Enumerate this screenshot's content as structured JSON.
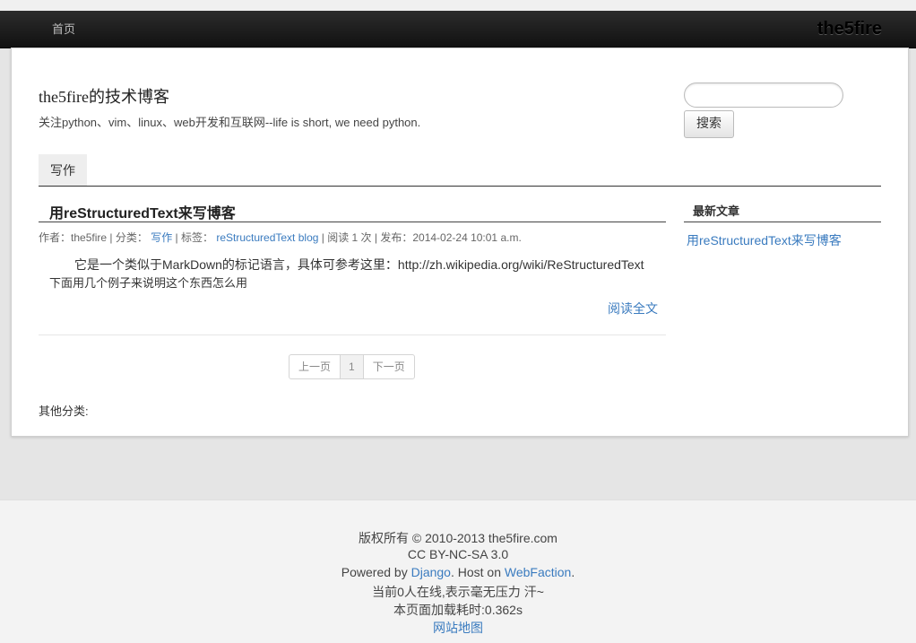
{
  "nav": {
    "home_label": "首页",
    "brand": "the5fire"
  },
  "site": {
    "title": "the5fire的技术博客",
    "tagline": "关注python、vim、linux、web开发和互联网--life is short, we need python."
  },
  "search": {
    "placeholder": "",
    "button_label": "搜索"
  },
  "category_tab": {
    "label": "写作"
  },
  "post": {
    "title": "用reStructuredText来写博客",
    "meta": {
      "author_label": "作者：",
      "author": "the5fire",
      "category_label": "| 分类：",
      "category": "写作",
      "tags_label": "| 标签：",
      "tags": [
        "reStructuredText",
        "blog"
      ],
      "reads": "| 阅读 1 次",
      "published": "| 发布：2014-02-24 10:01 a.m."
    },
    "body_line_1": "它是一个类似于MarkDown的标记语言，具体可参考这里：http://zh.wikipedia.org/wiki/ReStructuredText",
    "body_line_2": "下面用几个例子来说明这个东西怎么用",
    "read_more": "阅读全文"
  },
  "pagination": {
    "prev": "上一页",
    "current": "1",
    "next": "下一页"
  },
  "other_categories_label": "其他分类:",
  "sidebar": {
    "heading": "最新文章",
    "recent_posts": [
      "用reStructuredText来写博客"
    ]
  },
  "footer": {
    "copyright": "版权所有 © 2010-2013 the5fire.com",
    "license": "CC BY-NC-SA 3.0",
    "powered_prefix": "Powered by ",
    "powered_django": "Django",
    "powered_mid": ". Host on ",
    "powered_host": "WebFaction",
    "powered_suffix": ".",
    "online": "当前0人在线,表示毫无压力 汗~",
    "load_time": "本页面加载耗时:0.362s",
    "sitemap": "网站地图"
  },
  "colors": {
    "link": "#3a7bbf",
    "topbar": "#1b1b1b",
    "page_bg": "#e5e5e5"
  }
}
